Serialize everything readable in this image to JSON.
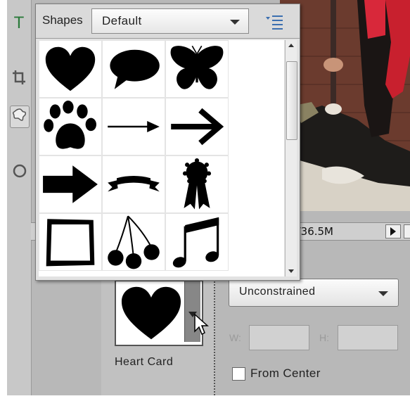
{
  "shapes_panel": {
    "title": "Shapes",
    "selected_set": "Default",
    "menu_icon": "panel-menu-icon",
    "shapes": [
      {
        "name": "heart-shape"
      },
      {
        "name": "speech-bubble-shape"
      },
      {
        "name": "butterfly-shape"
      },
      {
        "name": "paw-print-shape"
      },
      {
        "name": "thin-arrow-shape"
      },
      {
        "name": "bold-arrow-shape"
      },
      {
        "name": "fat-arrow-shape"
      },
      {
        "name": "banner-shape"
      },
      {
        "name": "ribbon-award-shape"
      },
      {
        "name": "rough-frame-shape"
      },
      {
        "name": "cherries-shape"
      },
      {
        "name": "music-notes-shape"
      }
    ]
  },
  "status_bar": {
    "doc_size": "/1/36.5M"
  },
  "options": {
    "current_shape_label": "Heart Card",
    "geometry_dropdown": "Unconstrained",
    "width_label": "W:",
    "height_label": "H:",
    "from_center_label": "From Center",
    "from_center_checked": false
  },
  "colors": {
    "panel_bg": "#e2e2e2",
    "app_bg": "#b8b8b8",
    "shape_fill": "#000000"
  }
}
